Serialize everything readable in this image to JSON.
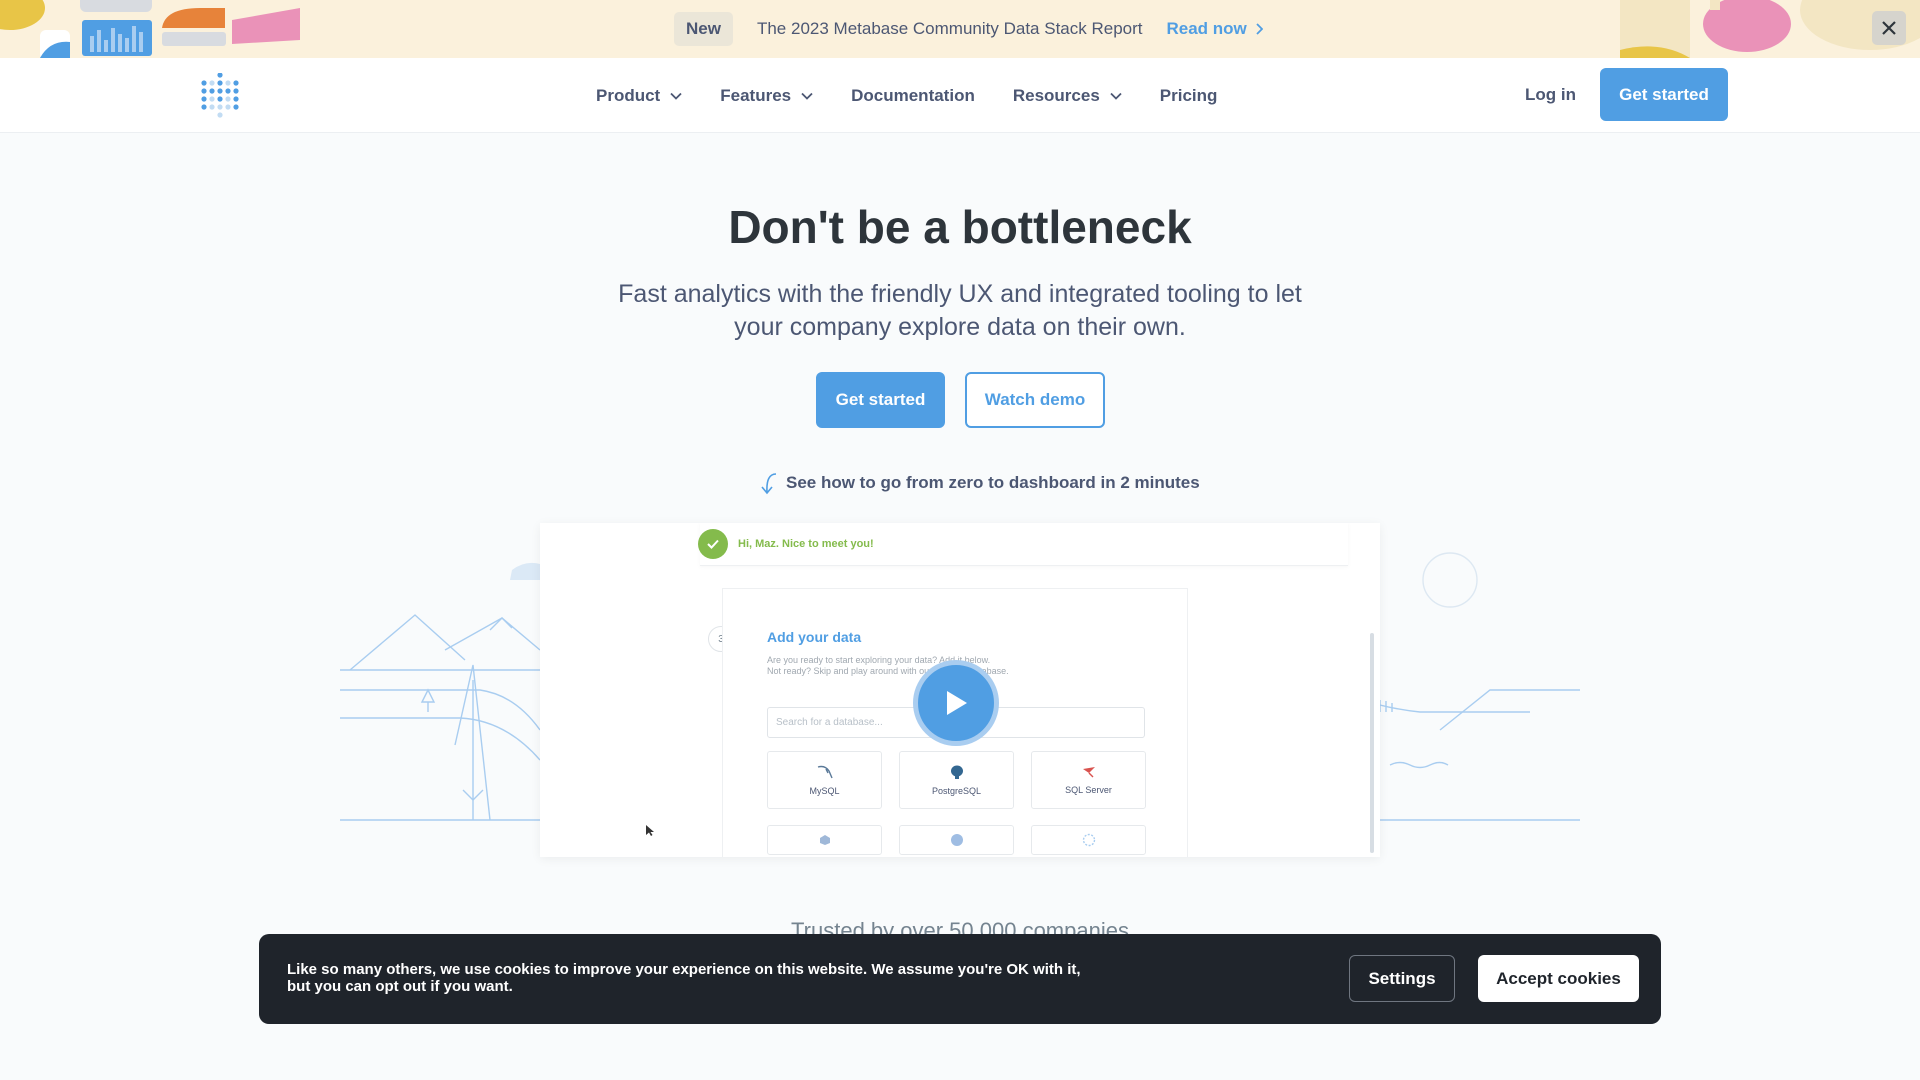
{
  "banner": {
    "badge": "New",
    "text": "The 2023 Metabase Community Data Stack Report",
    "link_label": "Read now",
    "close_icon": "close-icon"
  },
  "nav": {
    "logo_icon": "metabase-logo",
    "items": [
      {
        "label": "Product",
        "has_dropdown": true
      },
      {
        "label": "Features",
        "has_dropdown": true
      },
      {
        "label": "Documentation",
        "has_dropdown": false
      },
      {
        "label": "Resources",
        "has_dropdown": true
      },
      {
        "label": "Pricing",
        "has_dropdown": false
      }
    ],
    "login_label": "Log in",
    "cta_label": "Get started"
  },
  "hero": {
    "title": "Don't be a bottleneck",
    "subtitle": "Fast analytics with the friendly UX and integrated tooling to let your company explore data on their own.",
    "primary_label": "Get started",
    "secondary_label": "Watch demo",
    "demo_hint": "See how to go from zero to dashboard in 2 minutes"
  },
  "video": {
    "toast": "Hi, Maz. Nice to meet you!",
    "step": "3",
    "card_title": "Add your data",
    "card_desc_line1": "Are you ready to start exploring your data? Add it below.",
    "card_desc_line2": "Not ready? Skip and play around with our Sample Database.",
    "search_placeholder": "Search for a database...",
    "databases": [
      "MySQL",
      "PostgreSQL",
      "SQL Server"
    ],
    "play_icon": "play-icon"
  },
  "trusted": {
    "text": "Trusted by over 50,000 companies"
  },
  "cookie": {
    "text": "Like so many others, we use cookies to improve your experience on this website. We assume you're OK with it, but you can opt out if you want.",
    "settings_label": "Settings",
    "accept_label": "Accept cookies"
  },
  "colors": {
    "brand": "#509ee3",
    "banner_bg": "#fbf1dc",
    "text_dark": "#2e353b",
    "text_muted": "#4c5773",
    "success": "#84bb4c",
    "cookie_bg": "#1f242b"
  }
}
